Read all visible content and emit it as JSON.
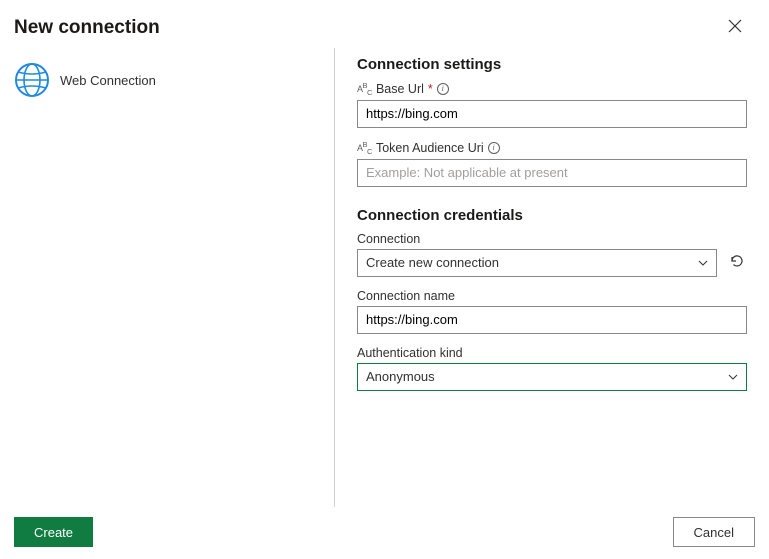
{
  "header": {
    "title": "New connection"
  },
  "left": {
    "item_label": "Web Connection"
  },
  "settings": {
    "title": "Connection settings",
    "base_url": {
      "label": "Base Url",
      "value": "https://bing.com"
    },
    "token_audience": {
      "label": "Token Audience Uri",
      "placeholder": "Example: Not applicable at present"
    }
  },
  "credentials": {
    "title": "Connection credentials",
    "connection": {
      "label": "Connection",
      "selected": "Create new connection"
    },
    "connection_name": {
      "label": "Connection name",
      "value": "https://bing.com"
    },
    "auth_kind": {
      "label": "Authentication kind",
      "selected": "Anonymous"
    }
  },
  "footer": {
    "create": "Create",
    "cancel": "Cancel"
  }
}
